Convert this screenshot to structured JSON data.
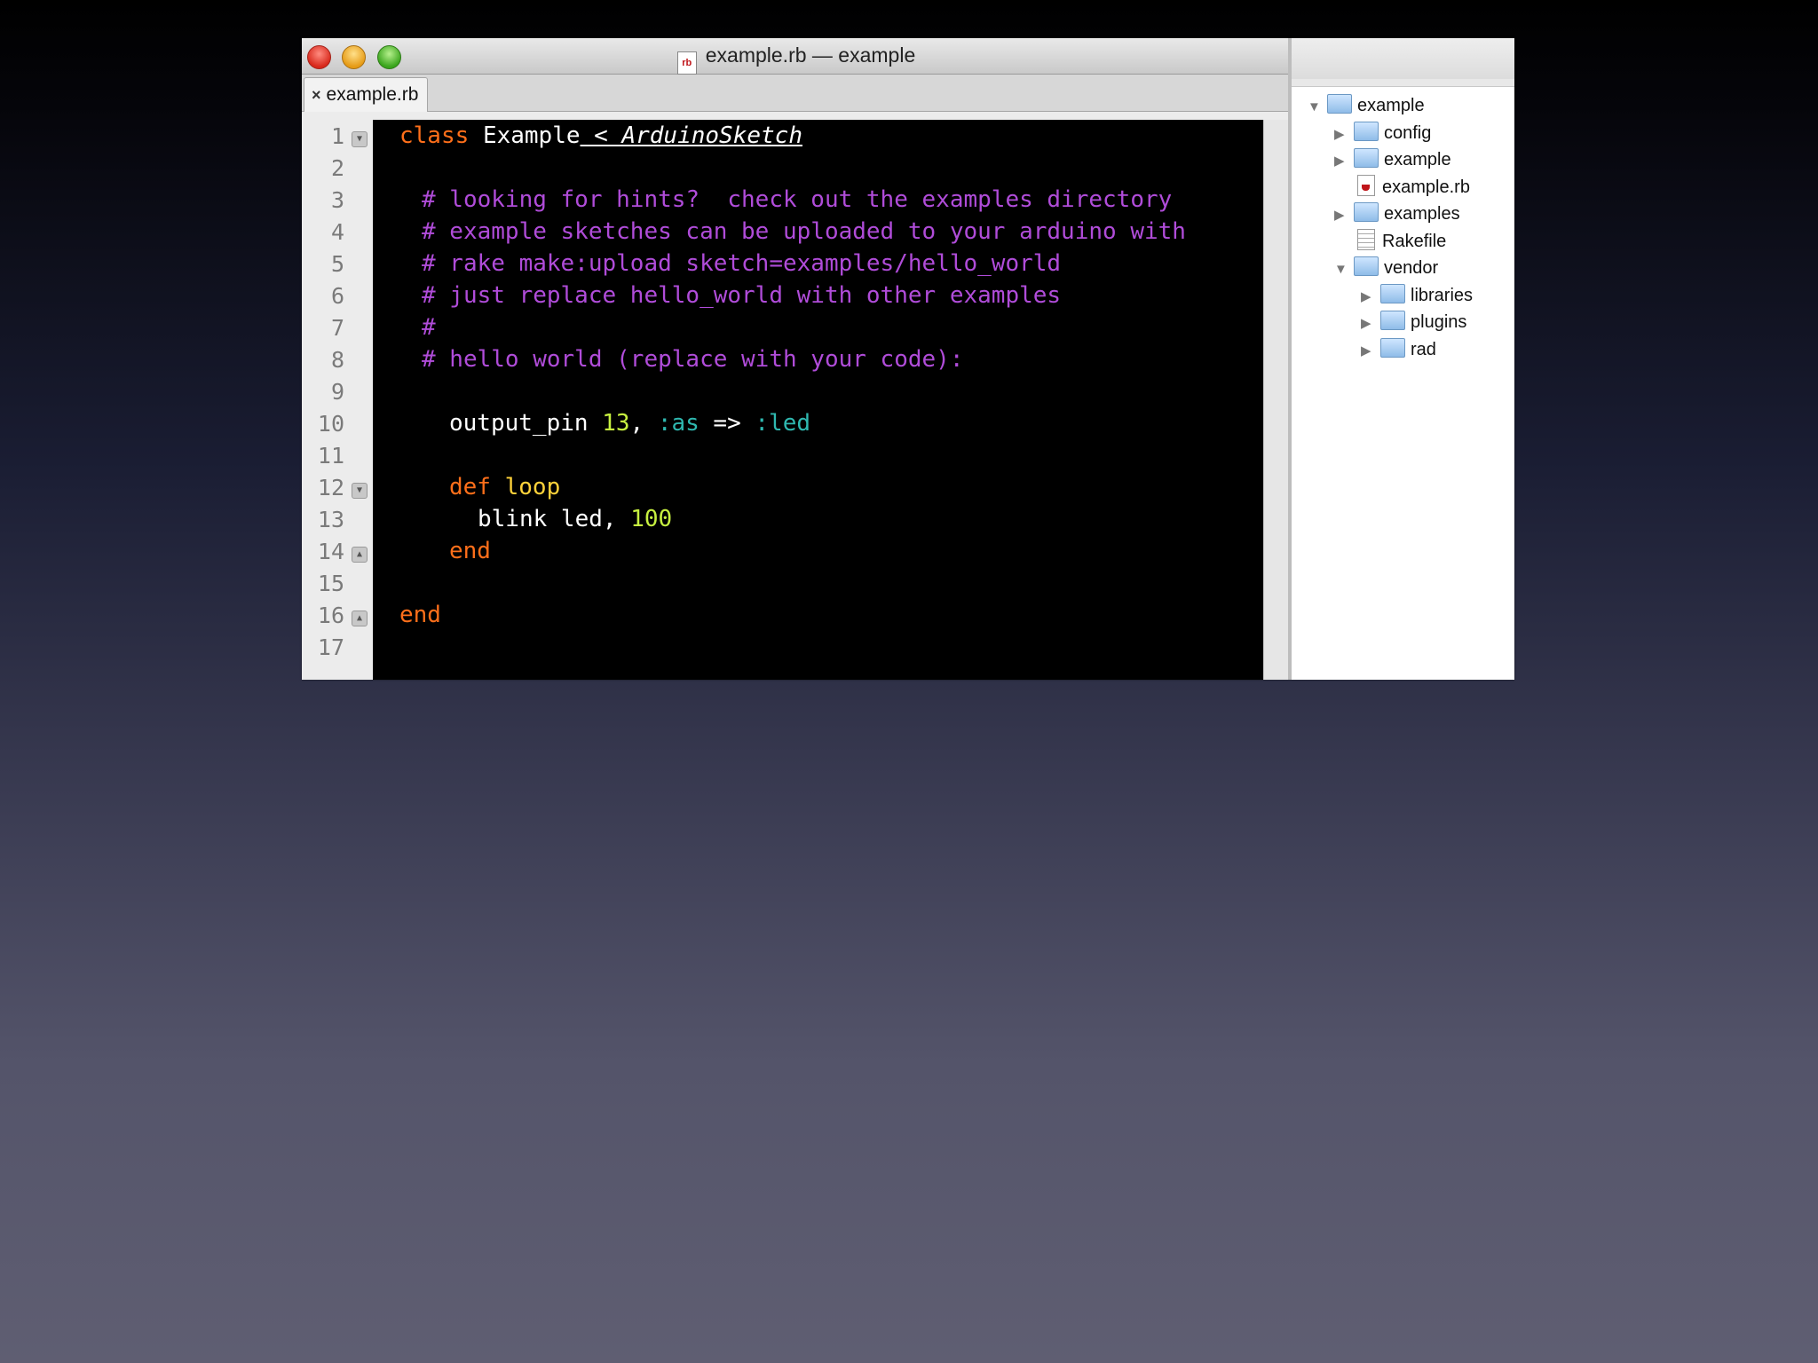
{
  "window": {
    "title": "example.rb — example",
    "active_tab": "example.rb",
    "tab_close_glyph": "×"
  },
  "editor": {
    "line_numbers": [
      "1",
      "2",
      "3",
      "4",
      "5",
      "6",
      "7",
      "8",
      "9",
      "10",
      "11",
      "12",
      "13",
      "14",
      "15",
      "16",
      "17"
    ],
    "fold_markers": {
      "1": "▼",
      "12": "▼",
      "14": "▲",
      "16": "▲"
    },
    "tokens": {
      "l1_class": "class",
      "l1_name": "Example",
      "l1_super": " < ArduinoSketch",
      "l3": "# looking for hints?  check out the examples directory",
      "l4": "# example sketches can be uploaded to your arduino with",
      "l5": "# rake make:upload sketch=examples/hello_world",
      "l6": "# just replace hello_world with other examples",
      "l7": "#",
      "l8": "# hello world (replace with your code):",
      "l10_call": "output_pin ",
      "l10_num": "13",
      "l10_comma": ", ",
      "l10_sym1": ":as",
      "l10_arrow": " => ",
      "l10_sym2": ":led",
      "l12_def": "def",
      "l12_name": "loop",
      "l13_call": "blink led, ",
      "l13_num": "100",
      "l14_end": "end",
      "l16_end": "end"
    }
  },
  "project_drawer": {
    "items": [
      {
        "label": "example",
        "kind": "folder",
        "expanded": true
      },
      {
        "label": "config",
        "kind": "folder",
        "expanded": false
      },
      {
        "label": "example",
        "kind": "folder",
        "expanded": false
      },
      {
        "label": "example.rb",
        "kind": "ruby-file"
      },
      {
        "label": "examples",
        "kind": "folder",
        "expanded": false
      },
      {
        "label": "Rakefile",
        "kind": "text-file"
      },
      {
        "label": "vendor",
        "kind": "folder",
        "expanded": true
      },
      {
        "label": "libraries",
        "kind": "folder",
        "expanded": false
      },
      {
        "label": "plugins",
        "kind": "folder",
        "expanded": false
      },
      {
        "label": "rad",
        "kind": "folder",
        "expanded": false
      }
    ],
    "disclosure_expanded": "▼",
    "disclosure_collapsed": "▶"
  },
  "colors": {
    "keyword": "#ff6f1a",
    "comment": "#b04cd9",
    "number": "#c7f040",
    "symbol": "#2fb8b0",
    "function_name": "#ffd23a",
    "editor_bg": "#000000"
  }
}
